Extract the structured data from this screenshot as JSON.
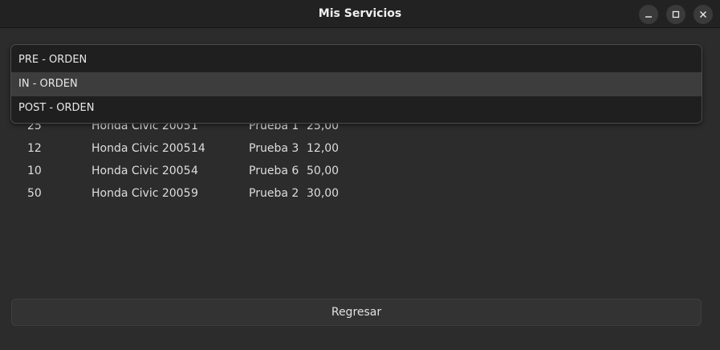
{
  "window": {
    "title": "Mis Servicios",
    "controls": {
      "minimize_icon": "minimize-icon",
      "maximize_icon": "maximize-icon",
      "close_icon": "close-icon"
    }
  },
  "dropdown": {
    "items": [
      {
        "label": "PRE - ORDEN",
        "selected": false
      },
      {
        "label": "IN - ORDEN",
        "selected": true
      },
      {
        "label": "POST - ORDEN",
        "selected": false
      }
    ]
  },
  "table": {
    "rows": [
      [
        "25",
        "Honda Civic 2005",
        "1",
        "Prueba 1",
        "25,00"
      ],
      [
        "12",
        "Honda Civic 2005",
        "14",
        "Prueba 3",
        "12,00"
      ],
      [
        "10",
        "Honda Civic 2005",
        "4",
        "Prueba 6",
        "50,00"
      ],
      [
        "50",
        "Honda Civic 2005",
        "9",
        "Prueba 2",
        "30,00"
      ]
    ]
  },
  "footer": {
    "back_label": "Regresar"
  },
  "colors": {
    "background": "#2c2c2c",
    "titlebar": "#222222",
    "dropdown_bg": "#1f1f1f",
    "dropdown_selected": "#3d3d3d"
  }
}
